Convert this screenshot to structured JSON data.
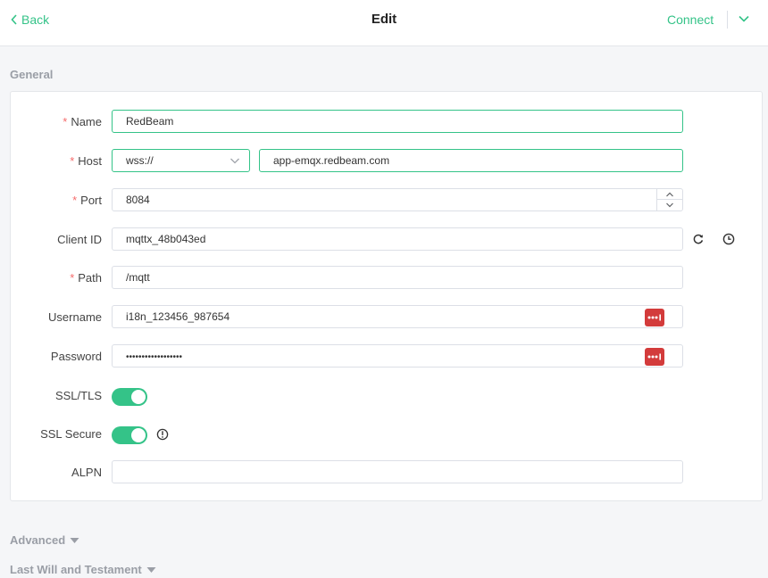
{
  "header": {
    "back_label": "Back",
    "title": "Edit",
    "connect_label": "Connect"
  },
  "sections": {
    "general": "General",
    "advanced": "Advanced",
    "last_will": "Last Will and Testament"
  },
  "form": {
    "name": {
      "label": "Name",
      "required": "*",
      "value": "RedBeam"
    },
    "host": {
      "label": "Host",
      "required": "*",
      "protocol": "wss://",
      "value": "app-emqx.redbeam.com"
    },
    "port": {
      "label": "Port",
      "required": "*",
      "value": "8084"
    },
    "client_id": {
      "label": "Client ID",
      "value": "mqttx_48b043ed"
    },
    "path": {
      "label": "Path",
      "required": "*",
      "value": "/mqtt"
    },
    "username": {
      "label": "Username",
      "value": "i18n_123456_987654"
    },
    "password": {
      "label": "Password",
      "value": "••••••••••••••••••"
    },
    "ssl_tls": {
      "label": "SSL/TLS",
      "enabled": true
    },
    "ssl_secure": {
      "label": "SSL Secure",
      "enabled": true
    },
    "alpn": {
      "label": "ALPN",
      "value": ""
    }
  },
  "colors": {
    "accent": "#34c388",
    "required": "#f56c6c",
    "password_icon_bg": "#d33b3b"
  },
  "icons": [
    "chevron-left-icon",
    "chevron-down-icon",
    "refresh-icon",
    "clock-icon",
    "info-icon",
    "password-manager-icon"
  ]
}
